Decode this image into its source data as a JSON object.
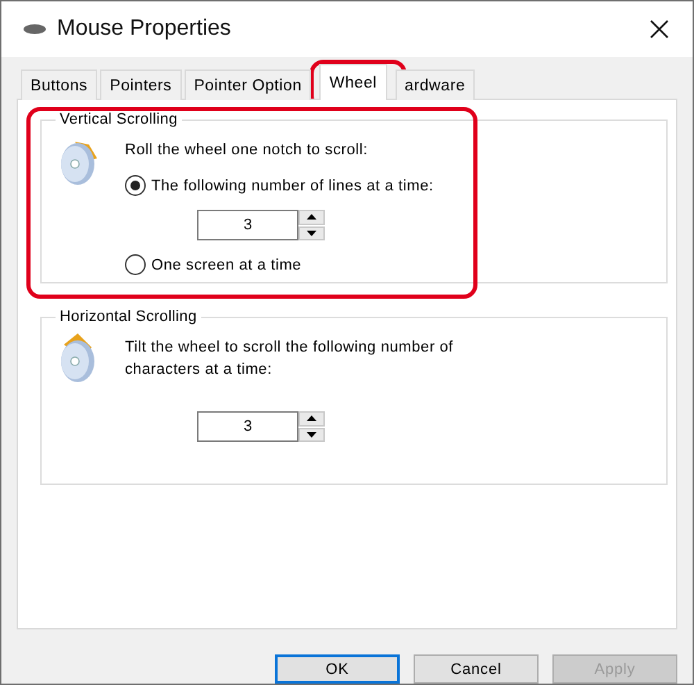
{
  "window": {
    "title": "Mouse Properties"
  },
  "tabs": [
    {
      "label": "Buttons",
      "selected": false
    },
    {
      "label": "Pointers",
      "selected": false
    },
    {
      "label": "Pointer Option",
      "selected": false
    },
    {
      "label": "Wheel",
      "selected": true
    },
    {
      "label": "ardware",
      "selected": false
    }
  ],
  "vertical_scrolling": {
    "title": "Vertical Scrolling",
    "prompt": "Roll the wheel one notch to scroll:",
    "options": [
      {
        "label": "The following number of lines at a time:",
        "selected": true,
        "spinner_value": "3"
      },
      {
        "label": "One screen at a time",
        "selected": false
      }
    ]
  },
  "horizontal_scrolling": {
    "title": "Horizontal Scrolling",
    "prompt": "Tilt the wheel to scroll the following number of characters at a time:",
    "spinner_value": "3"
  },
  "buttons": [
    {
      "label": "OK",
      "default": true,
      "disabled": false
    },
    {
      "label": "Cancel",
      "default": false,
      "disabled": false
    },
    {
      "label": "Apply",
      "default": false,
      "disabled": true
    }
  ]
}
